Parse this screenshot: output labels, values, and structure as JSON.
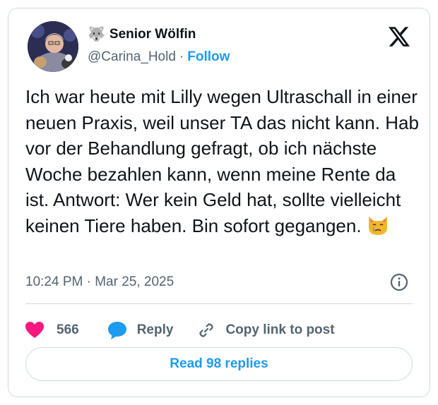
{
  "author": {
    "display_name": "Senior Wölfin",
    "wolf_emoji": "🐺",
    "handle": "@Carina_Hold",
    "separator": "·",
    "follow_label": "Follow"
  },
  "tweet": {
    "text": "Ich war heute mit Lilly wegen Ultraschall in einer neuen Praxis, weil unser TA das nicht kann. Hab vor der Behandlung gefragt, ob ich nächste Woche bezahlen kann, wenn meine Rente da ist. Antwort: Wer kein Geld hat, sollte vielleicht keinen Tiere haben. Bin sofort gegangen.",
    "emoji": "crying-cat-face",
    "timestamp": "10:24 PM · Mar 25, 2025"
  },
  "actions": {
    "like_count": "566",
    "reply_label": "Reply",
    "copy_label": "Copy link to post"
  },
  "read_replies_label": "Read 98 replies",
  "colors": {
    "accent": "#1d9bf0",
    "heart": "#f91880",
    "text": "#0f1419",
    "muted": "#536471",
    "border": "#cfd9de"
  },
  "icons": [
    "x-logo-icon",
    "info-icon",
    "heart-icon",
    "reply-bubble-icon",
    "link-icon",
    "wolf-icon",
    "crying-cat-icon"
  ]
}
